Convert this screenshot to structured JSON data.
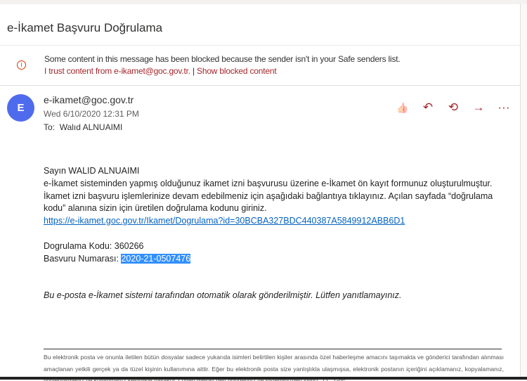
{
  "subject": "e-İkamet Başvuru Doğrulama",
  "warning": {
    "icon": "info-circle-icon",
    "message": "Some content in this message has been blocked because the sender isn't in your Safe senders list.",
    "trust_link": "I trust content from e-ikamet@goc.gov.tr.",
    "separator": "|",
    "show_link": "Show blocked content"
  },
  "sender": {
    "avatar": "E",
    "email": "e-ikamet@goc.gov.tr",
    "date": "Wed 6/10/2020 12:31 PM",
    "to_label": "To:",
    "to": "Walıd ALNUAIMI"
  },
  "actions": [
    {
      "icon": "like-icon",
      "glyph": "👍"
    },
    {
      "icon": "reply-icon",
      "glyph": "↶"
    },
    {
      "icon": "reply-all-icon",
      "glyph": "⟲"
    },
    {
      "icon": "forward-icon",
      "glyph": "→"
    },
    {
      "icon": "more-icon",
      "glyph": "···"
    }
  ],
  "body": {
    "greeting": "Sayın WALID ALNUAIMI",
    "paragraph": "e-İkamet sisteminden yapmış olduğunuz ikamet izni başvurusu üzerine e-İkamet ön kayıt formunuz oluşturulmuştur. İkamet izni başvuru işlemlerinize devam edebilmeniz için aşağıdaki bağlantıya tıklayınız. Açılan sayfada “doğrulama kodu” alanına sizin için üretilen doğrulama kodunu giriniz.",
    "link": "https://e-ikamet.goc.gov.tr/Ikamet/Dogrulama?id=30BCBA327BDC440387A5849912ABB6D1",
    "code_label": "Dogrulama Kodu:",
    "code": "360266",
    "app_label": "Basvuru Numarası:",
    "app_number": "2020-21-0507476",
    "note": "Bu e-posta e-İkamet sistemi tarafından otomatik olarak gönderilmiştir. Lütfen yanıtlamayınız."
  },
  "footer": "Bu elektronik posta ve onunla iletilen bütün dosyalar sadece yukarıda isimleri belirtilen kişiler arasında özel haberleşme amacını taşımakta ve gönderici tarafından alınması amaçlanan yetkili gerçek ya da tüzel kişinin kullanımına aittir. Eğer bu elektronik posta size yanlışlıkla ulaşmışsa, elektronik postanın içeriğini açıklamanız, kopyalamanız, yönlendirmeniz ve kullanmanız kesinlikle yasaktır. Lütfen mesajı geri gönderiniz ve sisteminizden siliniz. T.C. Göç"
}
